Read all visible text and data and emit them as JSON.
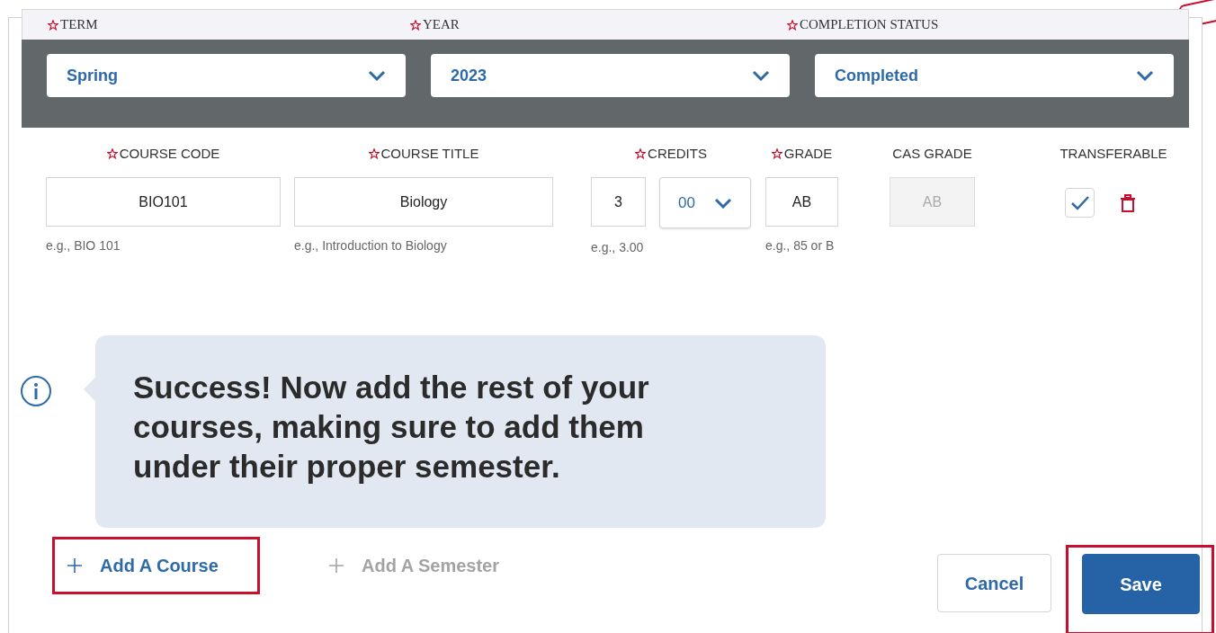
{
  "term_fields": [
    {
      "label": "TERM",
      "required": true,
      "value": "Spring"
    },
    {
      "label": "YEAR",
      "required": true,
      "value": "2023"
    },
    {
      "label": "COMPLETION STATUS",
      "required": true,
      "value": "Completed"
    }
  ],
  "course_columns": [
    {
      "label": "COURSE CODE",
      "required": true
    },
    {
      "label": "COURSE TITLE",
      "required": true
    },
    {
      "label": "CREDITS",
      "required": true
    },
    {
      "label": "GRADE",
      "required": true
    },
    {
      "label": "CAS GRADE",
      "required": false
    },
    {
      "label": "TRANSFERABLE",
      "required": false
    }
  ],
  "course": {
    "code": {
      "value": "BIO101",
      "hint": "e.g., BIO 101"
    },
    "title": {
      "value": "Biology",
      "hint": "e.g., Introduction to Biology"
    },
    "credits": {
      "value": "3",
      "decimal": "00",
      "hint": "e.g., 3.00"
    },
    "grade": {
      "value": "AB",
      "hint": "e.g., 85 or B"
    },
    "cas_grade": {
      "value": "AB",
      "disabled": true
    },
    "transferable": {
      "checked": true
    }
  },
  "tip": {
    "text": "Success! Now add the rest of your courses, making sure to add them under their proper semester."
  },
  "actions": [
    {
      "label": "Add A Course",
      "disabled": false,
      "highlighted": true
    },
    {
      "label": "Add A Semester",
      "disabled": true,
      "highlighted": false
    }
  ],
  "buttons": [
    {
      "label": "Cancel",
      "kind": "secondary",
      "highlighted": false
    },
    {
      "label": "Save",
      "kind": "primary",
      "highlighted": true
    }
  ]
}
